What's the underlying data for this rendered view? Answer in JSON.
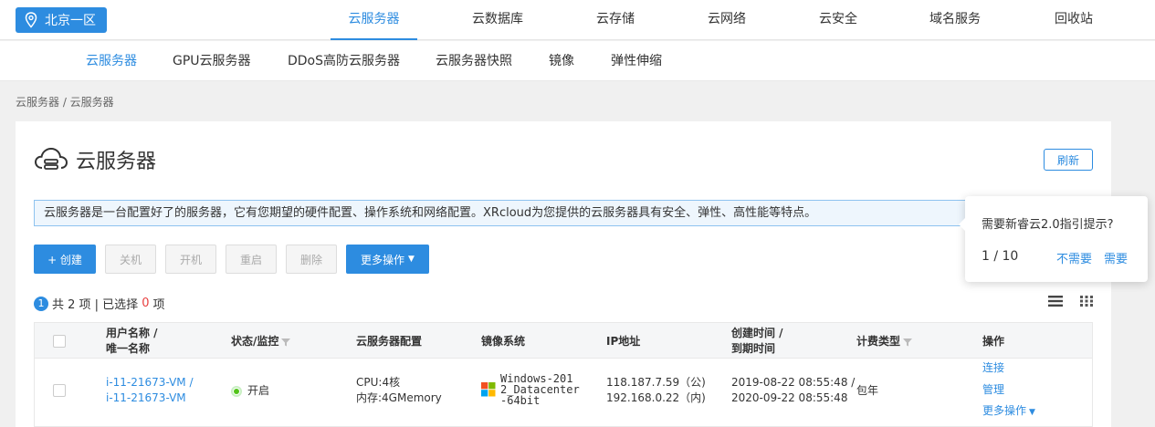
{
  "topnav": {
    "region": "北京一区",
    "items": [
      "云服务器",
      "云数据库",
      "云存储",
      "云网络",
      "云安全",
      "域名服务",
      "回收站"
    ]
  },
  "subnav": {
    "items": [
      "云服务器",
      "GPU云服务器",
      "DDoS高防云服务器",
      "云服务器快照",
      "镜像",
      "弹性伸缩"
    ]
  },
  "breadcrumb": "云服务器 / 云服务器",
  "page": {
    "title": "云服务器",
    "refresh": "刷新",
    "notice": "云服务器是一台配置好了的服务器，它有您期望的硬件配置、操作系统和网络配置。XRcloud为您提供的云服务器具有安全、弹性、高性能等特点。"
  },
  "toolbar": {
    "create": "+ 创建",
    "shutdown": "关机",
    "start": "开机",
    "restart": "重启",
    "delete": "删除",
    "more": "更多操作"
  },
  "summary": {
    "badge": "1",
    "total_prefix": "共 2 项 | 已选择",
    "selected": "0",
    "suffix": "项"
  },
  "table": {
    "headers": {
      "name_line1": "用户名称 /",
      "name_line2": "唯一名称",
      "status": "状态/监控",
      "config": "云服务器配置",
      "image": "镜像系统",
      "ip": "IP地址",
      "time_line1": "创建时间 /",
      "time_line2": "到期时间",
      "billing": "计费类型",
      "ops": "操作"
    },
    "rows": [
      {
        "name1": "i-11-21673-VM /",
        "name2": "i-11-21673-VM",
        "status": "开启",
        "cpu": "CPU:4核",
        "mem": "内存:4GMemory",
        "os1": "Windows-201",
        "os2": "2_Datacenter",
        "os3": "-64bit",
        "ip1": "118.187.7.59（公)",
        "ip2": "192.168.0.22（内)",
        "created": "2019-08-22 08:55:48 /",
        "expires": "2020-09-22 08:55:48",
        "billing": "包年",
        "op_connect": "连接",
        "op_manage": "管理",
        "op_more": "更多操作"
      }
    ]
  },
  "guide": {
    "question": "需要新睿云2.0指引提示?",
    "page": "1 / 10",
    "no": "不需要",
    "yes": "需要"
  },
  "colors": {
    "accent": "#2d8ce0",
    "danger": "#e84040",
    "status_on": "#52c41a"
  }
}
